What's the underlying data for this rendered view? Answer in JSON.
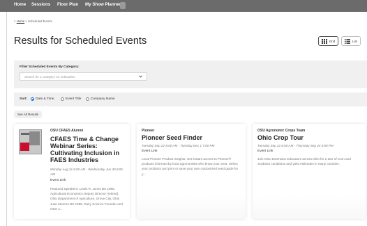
{
  "nav": {
    "items": [
      "Home",
      "Sessions",
      "Floor Plan",
      "My Show Planner"
    ]
  },
  "breadcrumb": {
    "home": "Home",
    "separator": ">",
    "current": "Scheduled Events"
  },
  "page": {
    "title": "Results for Scheduled Events"
  },
  "view_toggle": {
    "grid_label": "Grid",
    "list_label": "List",
    "active": "Grid"
  },
  "filter": {
    "label": "Filter Scheduled Events By Category:",
    "placeholder": "Search for a Category ex: Education"
  },
  "sort": {
    "label": "Sort:",
    "options": [
      "Date & Time",
      "Event Title",
      "Company Name"
    ],
    "selected": "Date & Time"
  },
  "see_all": {
    "label": "See All Results"
  },
  "cards": [
    {
      "category": "OSU CFAES Alumni",
      "title": "CFAES Time & Change Webinar Series: Cultivating Inclusion in FAES Industries",
      "when": "Monday Aug 31 8:00 AM - Wednesday Jun 30 8:05 AM",
      "link": "Event Link",
      "description": "Featured Speakers: Lewis R. Jones BS 1965, Agricultural Economics Deputy Director (retired), Ohio Department of Agriculture, Grove City, Ohio Juan Moreno BS 1988, Dairy Science Founder and CEO o..."
    },
    {
      "category": "Pioneer",
      "title": "Pioneer Seed Finder",
      "when": "Tuesday Sep 22 8:00 AM - Tuesday Dec 1 7:00 PM",
      "link": "Event Link",
      "description": "Local Pioneer Product Insights. Get instant access to Pioneer® products informed by local agronomists who know your area. Select your products and print or save your own customized seed guide for y..."
    },
    {
      "category": "OSU Agronomic Crops Team",
      "title": "Ohio Crop Tour",
      "when": "Tuesday Sep 22 8:00 AM - Thursday Sep 24 5:00 PM",
      "link": "Event Link",
      "description": "Join OSU Extension Educators across Ohio for a tour of Corn and Soybean conditions and yield estimates in many counties."
    }
  ],
  "colors": {
    "nav_bg": "#6b6b6b",
    "panel_bg": "#f0f0f0",
    "radio_accent": "#1a6ddc",
    "thumb_red": "#c8102e"
  }
}
